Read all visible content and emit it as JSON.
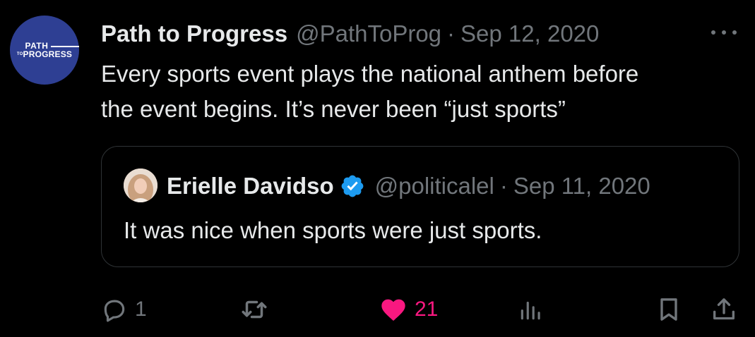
{
  "tweet": {
    "avatar": {
      "logo_line1": "PATH",
      "logo_to": "TO",
      "logo_line2": "PROGRESS",
      "bg_color": "#2e3f93"
    },
    "display_name": "Path to Progress",
    "handle": "@PathToProg",
    "separator": "·",
    "date": "Sep 12, 2020",
    "more_icon": "more-horizontal-icon",
    "text_line1": "Every sports event plays the national anthem before",
    "text_line2": "the event begins. It’s never been “just sports”"
  },
  "quote": {
    "display_name": "Erielle Davidso",
    "verified_icon": "verified-badge-icon",
    "verified_color": "#1d9bf0",
    "handle": "@politicalel",
    "separator": "·",
    "date": "Sep 11, 2020",
    "text": "It was nice when sports were just sports."
  },
  "actions": {
    "reply": {
      "icon": "reply-icon",
      "count": "1"
    },
    "retweet": {
      "icon": "retweet-icon",
      "count": ""
    },
    "like": {
      "icon": "heart-icon",
      "count": "21",
      "color": "#f91880"
    },
    "views": {
      "icon": "analytics-icon",
      "count": ""
    },
    "bookmark": {
      "icon": "bookmark-icon"
    },
    "share": {
      "icon": "share-icon"
    }
  },
  "colors": {
    "background": "#000000",
    "text_primary": "#e7e9ea",
    "text_secondary": "#71767b",
    "border": "#2f3336"
  }
}
